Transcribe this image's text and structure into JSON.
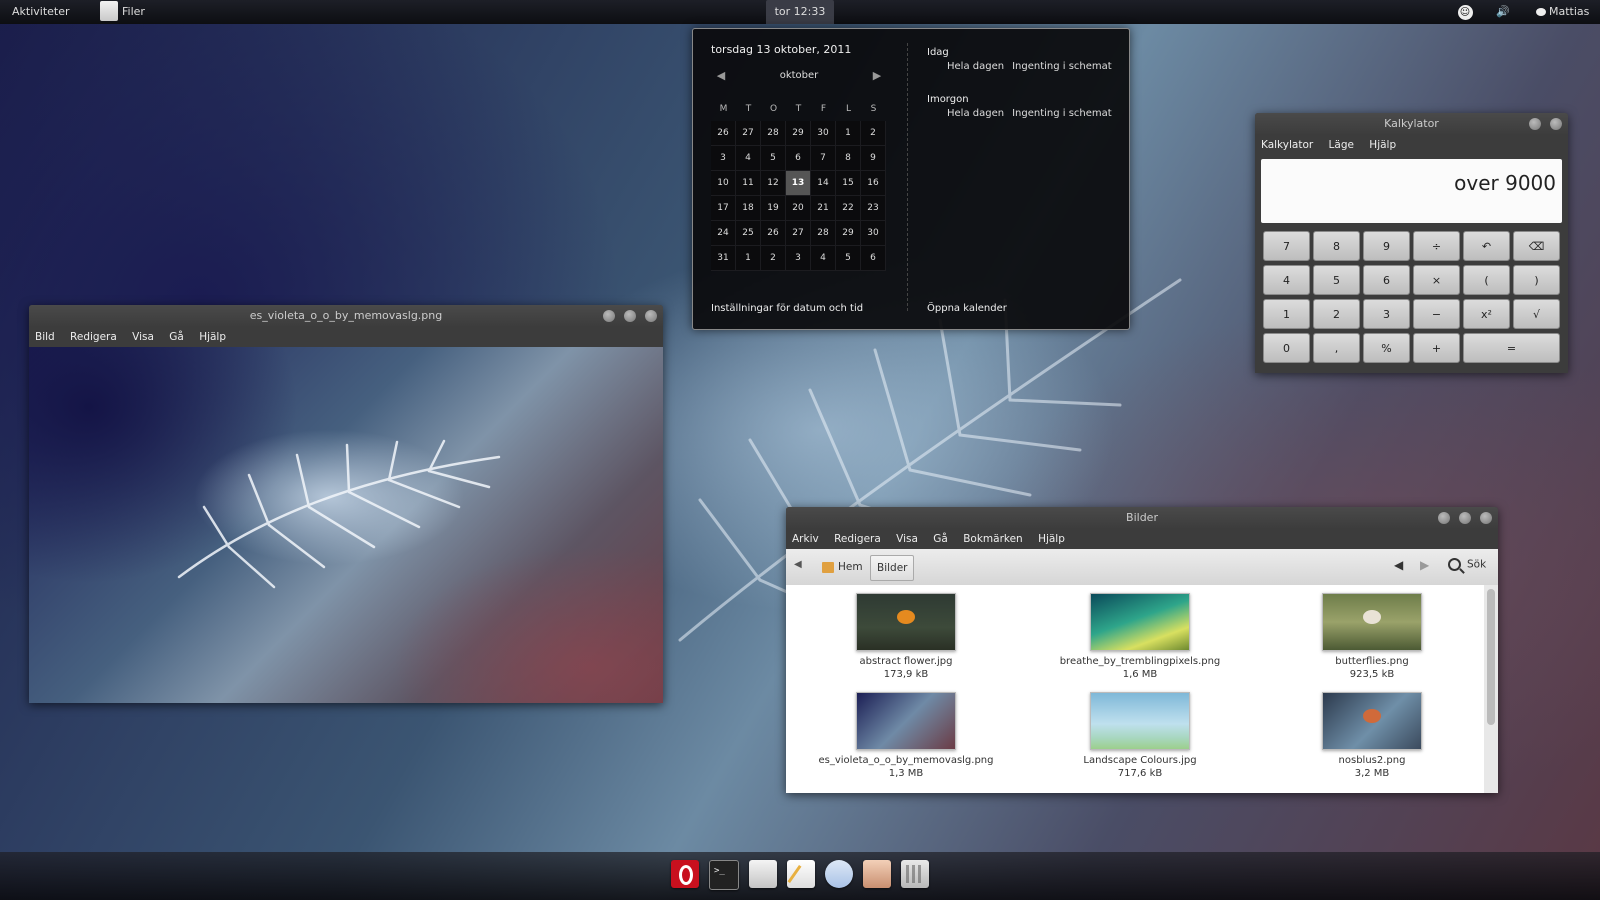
{
  "top_panel": {
    "activities": "Aktiviteter",
    "app_name": "Filer",
    "clock": "tor 12:33",
    "user": "Mattias"
  },
  "calendar": {
    "full_date": "torsdag 13 oktober, 2011",
    "month": "oktober",
    "weekdays": [
      "M",
      "T",
      "O",
      "T",
      "F",
      "L",
      "S"
    ],
    "weeks": [
      [
        "26",
        "27",
        "28",
        "29",
        "30",
        "1",
        "2"
      ],
      [
        "3",
        "4",
        "5",
        "6",
        "7",
        "8",
        "9"
      ],
      [
        "10",
        "11",
        "12",
        "13",
        "14",
        "15",
        "16"
      ],
      [
        "17",
        "18",
        "19",
        "20",
        "21",
        "22",
        "23"
      ],
      [
        "24",
        "25",
        "26",
        "27",
        "28",
        "29",
        "30"
      ],
      [
        "31",
        "1",
        "2",
        "3",
        "4",
        "5",
        "6"
      ]
    ],
    "today": "13",
    "events": [
      {
        "heading": "Idag",
        "when": "Hela dagen",
        "text": "Ingenting i schemat"
      },
      {
        "heading": "Imorgon",
        "when": "Hela dagen",
        "text": "Ingenting i schemat"
      }
    ],
    "settings_link": "Inställningar för datum och tid",
    "open_link": "Öppna kalender"
  },
  "viewer": {
    "title": "es_violeta_o_o_by_memovaslg.png",
    "menu": [
      "Bild",
      "Redigera",
      "Visa",
      "Gå",
      "Hjälp"
    ]
  },
  "calculator": {
    "title": "Kalkylator",
    "menu": [
      "Kalkylator",
      "Läge",
      "Hjälp"
    ],
    "display": "over 9000",
    "keys": [
      [
        "7",
        "8",
        "9",
        "÷",
        "↶",
        "⌫"
      ],
      [
        "4",
        "5",
        "6",
        "×",
        "(",
        ")"
      ],
      [
        "1",
        "2",
        "3",
        "−",
        "x²",
        "√"
      ],
      [
        "0",
        ",",
        "%",
        "+",
        "="
      ]
    ]
  },
  "files": {
    "title": "Bilder",
    "menu": [
      "Arkiv",
      "Redigera",
      "Visa",
      "Gå",
      "Bokmärken",
      "Hjälp"
    ],
    "crumb_home": "Hem",
    "crumb_current": "Bilder",
    "search": "Sök",
    "items": [
      {
        "name": "abstract flower.jpg",
        "size": "173,9 kB",
        "thumb": "linear-gradient(#2e3a33,#3d4a3a 60%,#2a3025)",
        "accent": "#e58a1f"
      },
      {
        "name": "breathe_by_tremblingpixels.png",
        "size": "1,6 MB",
        "thumb": "linear-gradient(160deg,#0a4a5a,#2ea58a 45%,#d8e060 75%,#6e8a30)",
        "accent": ""
      },
      {
        "name": "butterflies.png",
        "size": "923,5 kB",
        "thumb": "linear-gradient(#6e7d4a,#9aa26a 50%,#4c5a34)",
        "accent": "#e9e2d6"
      },
      {
        "name": "es_violeta_o_o_by_memovaslg.png",
        "size": "1,3 MB",
        "thumb": "linear-gradient(135deg,#1c1f55,#6f8aa6 50%,#6b3c45)",
        "accent": ""
      },
      {
        "name": "Landscape Colours.jpg",
        "size": "717,6 kB",
        "thumb": "linear-gradient(#7fb8d8,#bfe0ee 55%,#a8d7c0 80%,#9ccf8c)",
        "accent": ""
      },
      {
        "name": "nosblus2.png",
        "size": "3,2 MB",
        "thumb": "linear-gradient(135deg,#2c3a4d,#6f8fa8 55%,#3b4a5d)",
        "accent": "#d06a3a"
      }
    ]
  },
  "dock": {
    "apps": [
      "opera-icon",
      "terminal-icon",
      "file-manager-icon",
      "text-editor-icon",
      "chat-icon",
      "eye-of-gnome-icon",
      "calculator-icon"
    ]
  }
}
